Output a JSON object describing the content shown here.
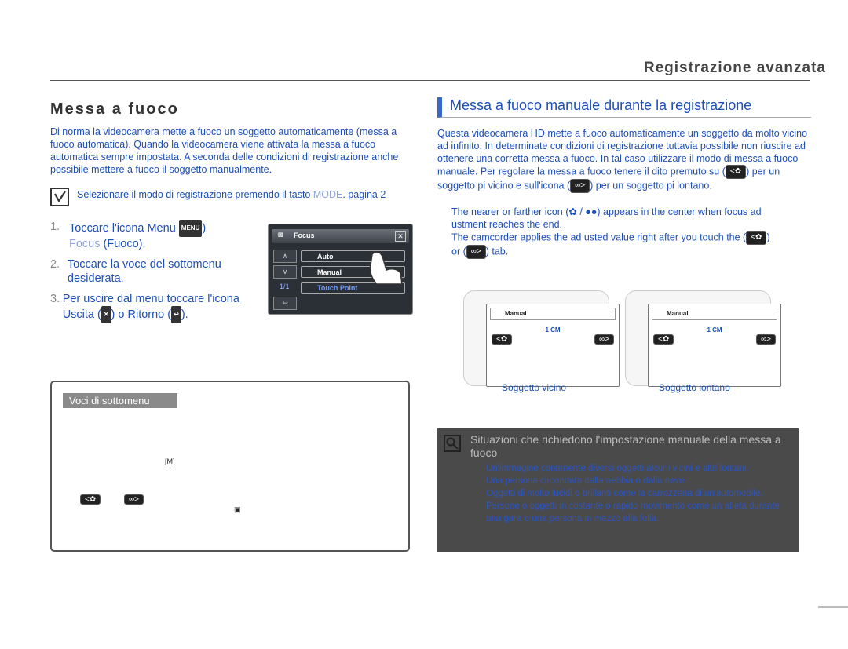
{
  "header": {
    "title": "Registrazione avanzata"
  },
  "left": {
    "section_title": "Messa a fuoco",
    "intro": "Di norma la videocamera mette a fuoco un soggetto automaticamente (messa a fuoco automatica). Quando la videocamera viene attivata  la messa a fuoco automatica  sempre impostata. A seconda delle condizioni di registrazione anche possibile mettere a fuoco il soggetto manualmente.",
    "note_text": "Selezionare il modo di registrazione premendo il tasto",
    "note_mode": "MODE",
    "note_page": ". pagina 2",
    "steps": [
      {
        "num": "1.",
        "text_a": "Toccare l'icona Menu",
        "key": "MENU",
        "text_b": ")",
        "text_c": "Focus",
        "text_d": " (Fuoco)."
      },
      {
        "num": "2.",
        "text_a": "Toccare la voce del sottomenu desiderata."
      },
      {
        "num": "3.",
        "text_a": "Per uscire dal menu  toccare l'icona Uscita (",
        "text_b": ") o Ritorno (",
        "text_c": ")."
      }
    ],
    "camera_menu": {
      "title": "Focus",
      "items": [
        "Auto",
        "Manual",
        "Touch Point"
      ],
      "page": "1/1"
    },
    "submenu_title": "Voci di sottomenu"
  },
  "right": {
    "section_title": "Messa a fuoco manuale durante la registrazione",
    "intro_a": "Questa videocamera HD mette a fuoco automaticamente un soggetto da molto vicino ad infinito. In determinate condizioni di registrazione  tuttavia  possibile non riuscire ad ottenere una corretta messa a fuoco. In tal caso  utilizzare il modo di messa a fuoco manuale. Per regolare la messa a fuoco  tenere il dito premuto su (",
    "intro_b": ") per un soggetto pi vicino  e sull'icona (",
    "intro_c": ") per un soggetto pi lontano.",
    "bullet1": "The nearer or farther icon (",
    "bullet1_b": " / ",
    "bullet1_c": ") appears in the center when focus ad ustment reaches the end.",
    "bullet2": "The camcorder applies the ad usted value right after you touch the (",
    "bullet2_b": ")",
    "bullet2_c": "or (",
    "bullet2_d": ") tab.",
    "screens": [
      {
        "title": "Manual",
        "distance": "1 CM",
        "caption": "Soggetto vicino"
      },
      {
        "title": "Manual",
        "distance": "1 CM",
        "caption": "Soggetto lontano"
      }
    ],
    "warn_title": "Situazioni che richiedono l'impostazione manuale della messa a fuoco",
    "warn_items": [
      "Un'immagine contenente diversi oggetti  alcuni vicini e altri lontani.",
      "Una persona circondata dalla nebbia o dalla neve.",
      "Oggetti di molto lucidi o brillanti come la carrozzeria di un'automobile.",
      "Persone o oggetti in costante o rapido movimento come un atleta durante una gara o una persona in mezzo alla folla."
    ]
  },
  "page_number": "  "
}
